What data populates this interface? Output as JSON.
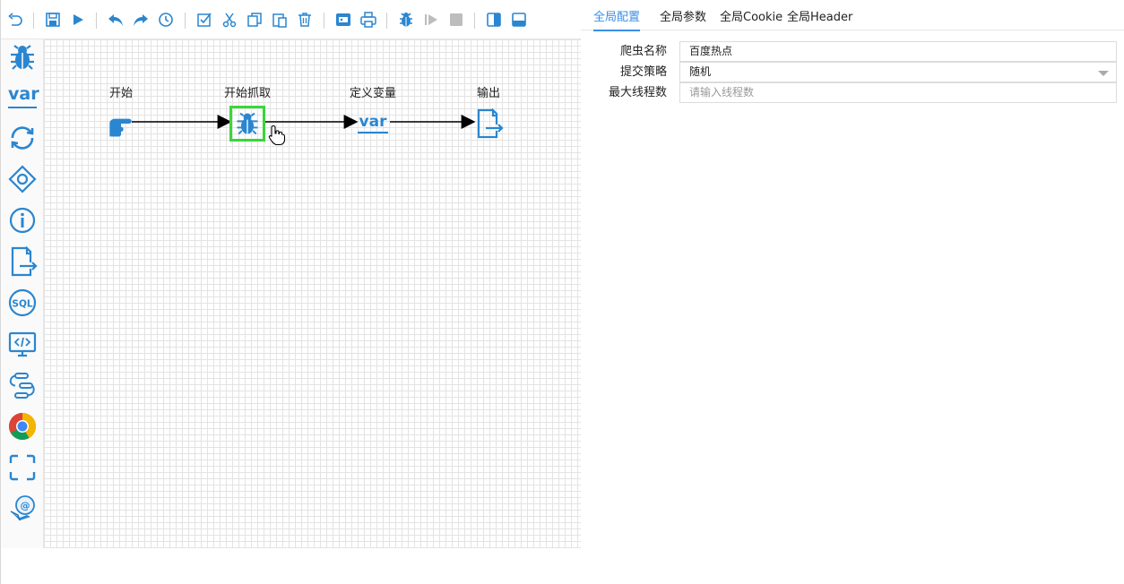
{
  "toolbar": {
    "buttons": [
      "undo-icon",
      "save-icon",
      "run-icon",
      "back-icon",
      "forward-icon",
      "history-icon",
      "select-all-icon",
      "cut-icon",
      "copy-icon",
      "paste-icon",
      "delete-icon",
      "export-image-icon",
      "print-icon",
      "debug-icon",
      "resume-icon",
      "stop-icon",
      "toggle-right-panel-icon",
      "toggle-bottom-panel-icon"
    ]
  },
  "palette": {
    "items": [
      "spider-icon",
      "variable-icon",
      "loop-icon",
      "condition-icon",
      "info-icon",
      "output-icon",
      "sql-icon",
      "script-icon",
      "process-icon",
      "chrome-icon",
      "capture-icon",
      "email-icon"
    ],
    "var_text": "var"
  },
  "flow": {
    "nodes": [
      {
        "label": "开始",
        "icon": "start-hand-icon"
      },
      {
        "label": "开始抓取",
        "icon": "spider-icon"
      },
      {
        "label": "定义变量",
        "icon": "variable-icon",
        "text": "var"
      },
      {
        "label": "输出",
        "icon": "output-icon"
      }
    ]
  },
  "tabs": [
    {
      "label": "全局配置",
      "active": true
    },
    {
      "label": "全局参数",
      "active": false
    },
    {
      "label": "全局Cookie",
      "active": false
    },
    {
      "label": "全局Header",
      "active": false
    }
  ],
  "form": {
    "spider_name_label": "爬虫名称",
    "spider_name_value": "百度热点",
    "strategy_label": "提交策略",
    "strategy_value": "随机",
    "max_threads_label": "最大线程数",
    "max_threads_placeholder": "请输入线程数"
  },
  "colors": {
    "accent": "#3a8ee6",
    "icon_blue": "#2a86d0",
    "selected_border": "#3ad63a"
  }
}
